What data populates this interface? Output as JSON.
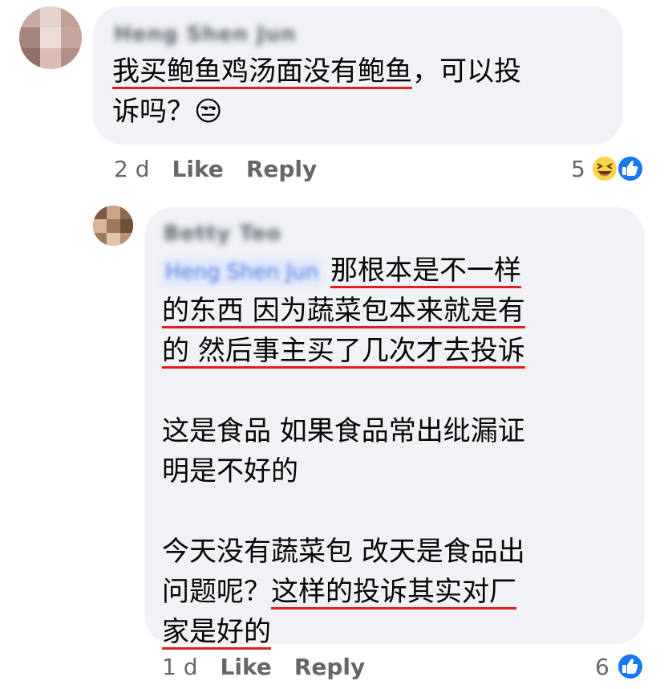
{
  "comment1": {
    "author": "Heng Shen Jun",
    "lines": [
      {
        "u": "我买鲍鱼鸡汤面没有鲍鱼",
        "rest": "，可以投"
      },
      {
        "u": "",
        "rest": "诉吗？😒"
      }
    ],
    "time": "2 d",
    "like_label": "Like",
    "reply_label": "Reply",
    "reaction_count": "5",
    "reaction_icons": [
      "laugh-emoji-icon",
      "thumbs-up-icon"
    ]
  },
  "comment2": {
    "author": "Betty Teo",
    "mention": "Heng Shen Jun",
    "lines": [
      {
        "u": "那根本是不一样"
      },
      {
        "u": "的东西 因为蔬菜包本来就是有"
      },
      {
        "u": "的 然后事主买了几次才去投诉"
      },
      {
        "plain": ""
      },
      {
        "plain": "这是食品 如果食品常出纰漏证"
      },
      {
        "plain": "明是不好的"
      },
      {
        "plain": ""
      },
      {
        "plain": "今天没有蔬菜包 改天是食品出"
      },
      {
        "pre": "问题呢？",
        "u": "这样的投诉其实对厂"
      },
      {
        "u": "家是好的"
      }
    ],
    "time": "1 d",
    "like_label": "Like",
    "reply_label": "Reply",
    "reaction_count": "6",
    "reaction_icons": [
      "thumbs-up-icon"
    ]
  },
  "colors": {
    "bubble": "#f0f2f5",
    "underline": "#e02020",
    "like_blue": "#1877f2",
    "meta_gray": "#65676b"
  }
}
